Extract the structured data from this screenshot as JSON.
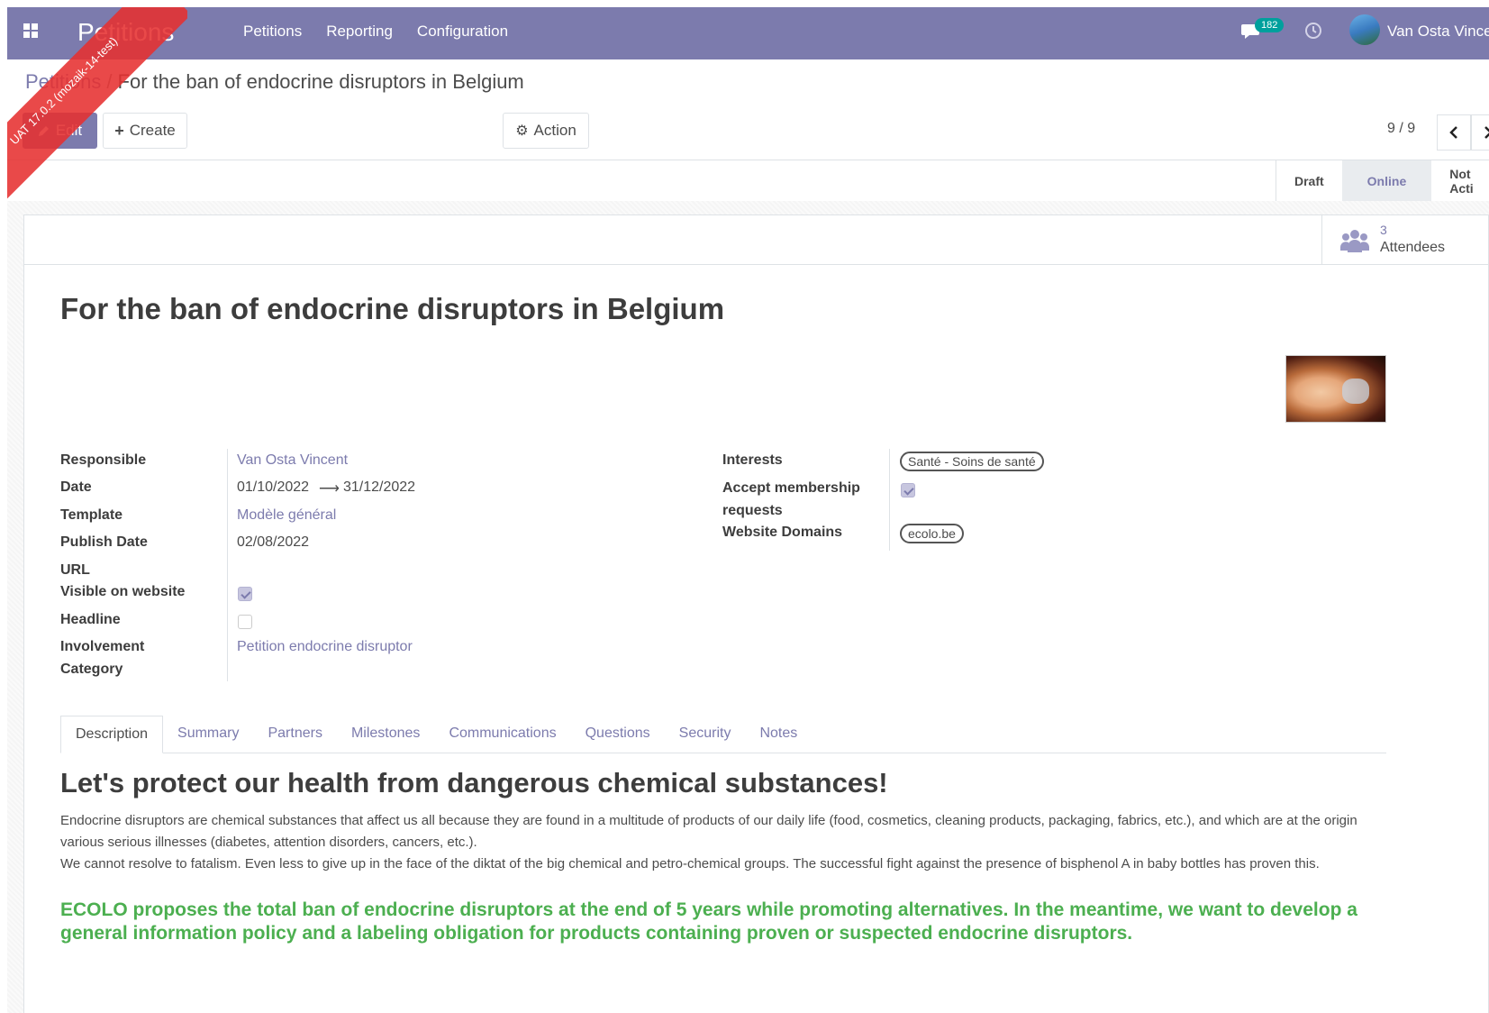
{
  "navbar": {
    "app_name": "Petitions",
    "menu": [
      "Petitions",
      "Reporting",
      "Configuration"
    ],
    "chat_count": "182",
    "user_name": "Van Osta Vince",
    "color": "#7c7bad"
  },
  "ribbon": {
    "text": "UAT 17.0.2 (mozaik-14-test)",
    "color": "#e63030"
  },
  "breadcrumb": {
    "parent": "Petitions",
    "current": "For the ban of endocrine disruptors in Belgium"
  },
  "toolbar": {
    "edit_label": "Edit",
    "create_label": "Create",
    "action_label": "Action"
  },
  "pager": {
    "value": "9 / 9"
  },
  "statusbar": {
    "stages": [
      "Draft",
      "Online",
      "Not Acti"
    ],
    "active": "Online"
  },
  "stat_button": {
    "value": "3",
    "label": "Attendees"
  },
  "record": {
    "title": "For the ban of endocrine disruptors in Belgium",
    "left": {
      "responsible_label": "Responsible",
      "responsible": "Van Osta Vincent",
      "date_label": "Date",
      "date_start": "01/10/2022",
      "date_end": "31/12/2022",
      "template_label": "Template",
      "template": "Modèle général",
      "publish_date_label": "Publish Date",
      "publish_date": "02/08/2022",
      "url_label": "URL",
      "visible_label": "Visible on website",
      "visible": true,
      "headline_label": "Headline",
      "headline": false,
      "involvement_label_1": "Involvement",
      "involvement_label_2": "Category",
      "involvement": "Petition endocrine disruptor"
    },
    "right": {
      "interests_label": "Interests",
      "interests": [
        "Santé - Soins de santé"
      ],
      "accept_label_1": "Accept membership",
      "accept_label_2": "requests",
      "accept": true,
      "domains_label": "Website Domains",
      "domains": [
        "ecolo.be"
      ]
    }
  },
  "tabs": [
    "Description",
    "Summary",
    "Partners",
    "Milestones",
    "Communications",
    "Questions",
    "Security",
    "Notes"
  ],
  "active_tab": "Description",
  "description": {
    "heading": "Let's protect our health from dangerous chemical substances!",
    "p1": "Endocrine disruptors are chemical substances that affect us all because they are found in a multitude of products of our daily life (food, cosmetics, cleaning products, packaging, fabrics, etc.), and which are at the origin various serious illnesses (diabetes, attention disorders, cancers, etc.).",
    "p2": "We cannot resolve to fatalism. Even less to give up in the face of the diktat of the big chemical and petro-chemical groups. The successful fight against the presence of bisphenol A in baby bottles has proven this.",
    "highlight": "ECOLO proposes the total ban of endocrine disruptors at the end of 5 years while promoting alternatives. In the meantime, we want to develop a general information policy and a labeling obligation for products containing proven or suspected endocrine disruptors.",
    "highlight_color": "#4caf50"
  }
}
